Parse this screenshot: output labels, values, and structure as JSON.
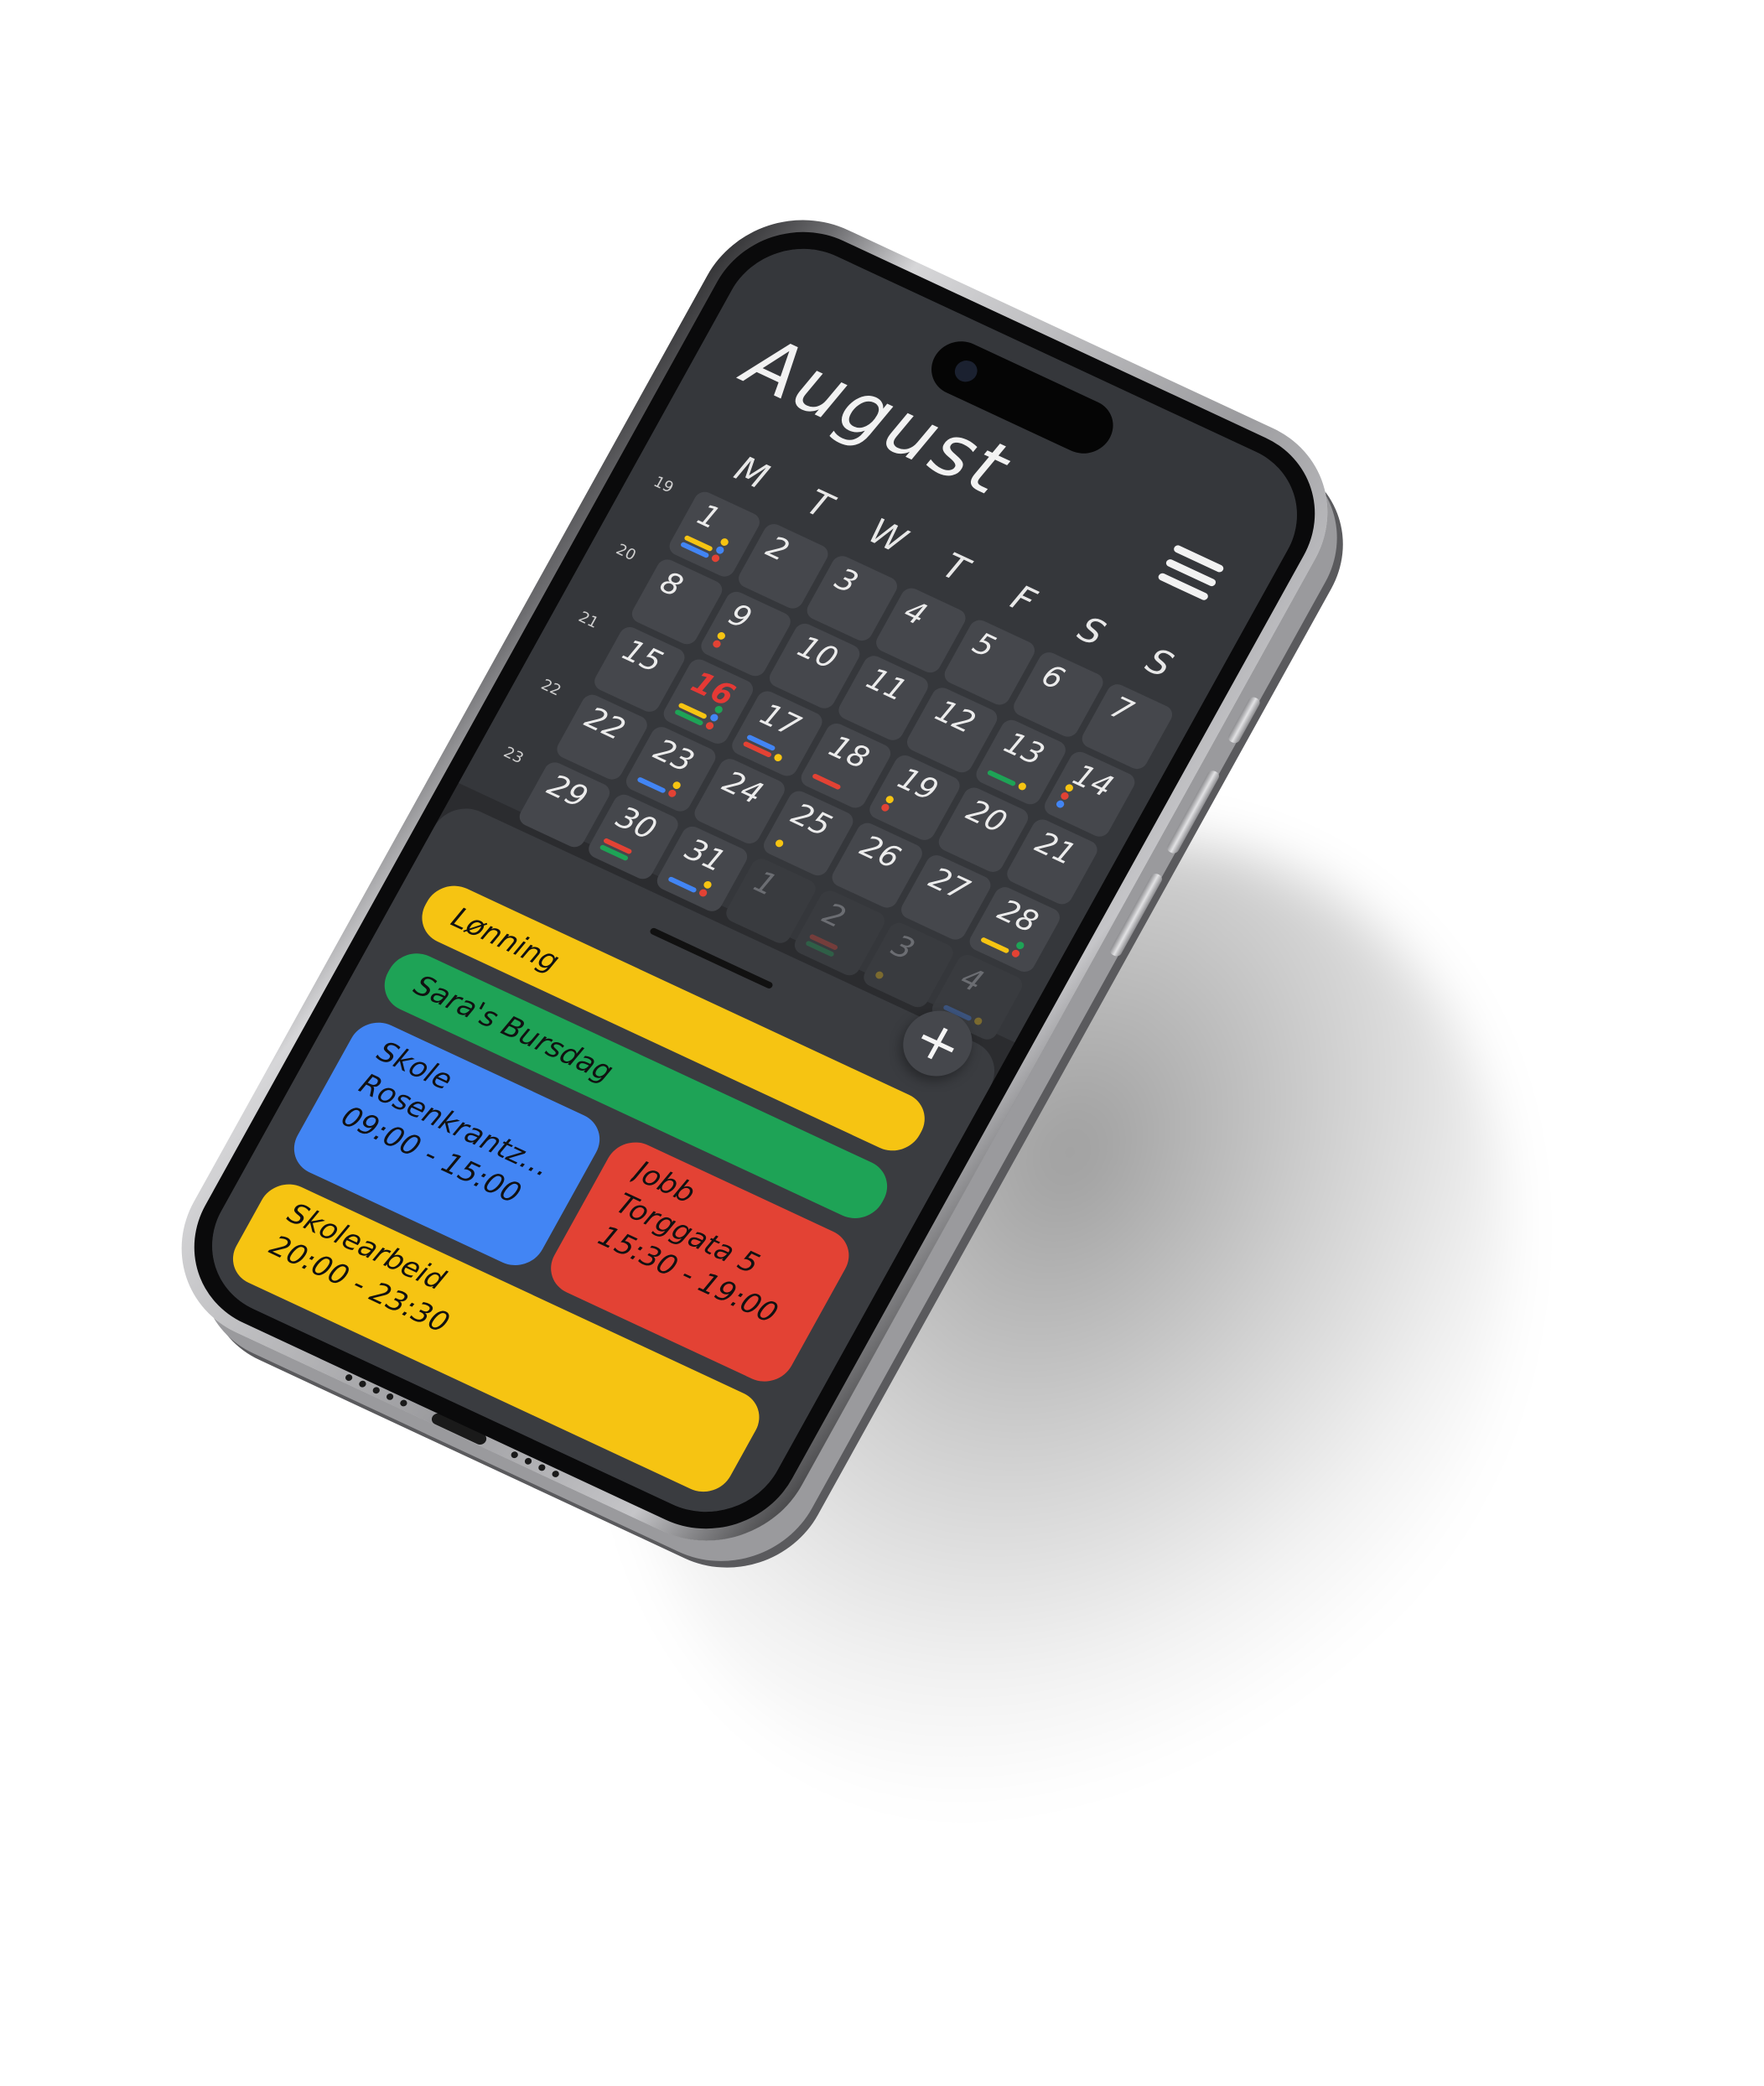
{
  "calendar": {
    "month": "August",
    "weekdays": [
      "M",
      "T",
      "W",
      "T",
      "F",
      "S",
      "S"
    ],
    "week_numbers": [
      "19",
      "20",
      "21",
      "22",
      "23"
    ],
    "colors": {
      "blue": "#4285f4",
      "yellow": "#f6c412",
      "green": "#1ea356",
      "red": "#e34234"
    },
    "days": [
      {
        "num": "1",
        "markers": [
          "bar:yellow",
          "bar:blue",
          "dot:yellow",
          "dot:blue",
          "dot:red"
        ]
      },
      {
        "num": "2",
        "markers": []
      },
      {
        "num": "3",
        "markers": []
      },
      {
        "num": "4",
        "markers": []
      },
      {
        "num": "5",
        "markers": []
      },
      {
        "num": "6",
        "markers": []
      },
      {
        "num": "7",
        "markers": []
      },
      {
        "num": "8",
        "markers": []
      },
      {
        "num": "9",
        "markers": [
          "dot:yellow",
          "dot:red"
        ]
      },
      {
        "num": "10",
        "markers": []
      },
      {
        "num": "11",
        "markers": []
      },
      {
        "num": "12",
        "markers": []
      },
      {
        "num": "13",
        "markers": [
          "bar:green",
          "dot:yellow"
        ]
      },
      {
        "num": "14",
        "markers": [
          "dot:yellow",
          "dot:red",
          "dot:blue"
        ]
      },
      {
        "num": "15",
        "markers": []
      },
      {
        "num": "16",
        "today": true,
        "markers": [
          "bar:yellow",
          "bar:green",
          "dot:green",
          "dot:blue",
          "dot:red"
        ]
      },
      {
        "num": "17",
        "markers": [
          "bar:blue",
          "bar:red",
          "dot:yellow"
        ]
      },
      {
        "num": "18",
        "markers": [
          "bar:red"
        ]
      },
      {
        "num": "19",
        "markers": [
          "dot:yellow",
          "dot:red"
        ]
      },
      {
        "num": "20",
        "markers": []
      },
      {
        "num": "21",
        "markers": []
      },
      {
        "num": "22",
        "markers": []
      },
      {
        "num": "23",
        "markers": [
          "bar:blue",
          "dot:yellow",
          "dot:red"
        ]
      },
      {
        "num": "24",
        "markers": []
      },
      {
        "num": "25",
        "markers": [
          "dot:yellow"
        ]
      },
      {
        "num": "26",
        "markers": []
      },
      {
        "num": "27",
        "markers": []
      },
      {
        "num": "28",
        "markers": [
          "bar:yellow",
          "dot:green",
          "dot:red"
        ]
      },
      {
        "num": "29",
        "markers": []
      },
      {
        "num": "30",
        "markers": [
          "bar:red",
          "bar:green"
        ]
      },
      {
        "num": "31",
        "markers": [
          "bar:blue",
          "dot:yellow",
          "dot:red"
        ]
      },
      {
        "num": "1",
        "faded": true,
        "markers": []
      },
      {
        "num": "2",
        "faded": true,
        "markers": [
          "bar:red",
          "bar:green"
        ]
      },
      {
        "num": "3",
        "faded": true,
        "markers": [
          "dot:yellow"
        ]
      },
      {
        "num": "4",
        "faded": true,
        "markers": [
          "bar:blue",
          "dot:yellow"
        ]
      }
    ]
  },
  "add_button": {
    "label": "+"
  },
  "events": [
    {
      "id": "lonning",
      "color": "yellow",
      "lines": [
        "Lønning"
      ]
    },
    {
      "id": "bursdag",
      "color": "green",
      "lines": [
        "Sara's Bursdag"
      ]
    },
    {
      "id": "skole",
      "color": "blue",
      "lines": [
        "Skole",
        "Rosenkrantz' g...",
        "09:00 - 15:00"
      ]
    },
    {
      "id": "jobb",
      "color": "red",
      "lines": [
        "Jobb",
        "Torggata 5",
        "15:30 - 19:00"
      ]
    },
    {
      "id": "skolearbeid",
      "color": "yellow",
      "lines": [
        "Skolearbeid",
        "20:00 - 23:30"
      ]
    }
  ]
}
